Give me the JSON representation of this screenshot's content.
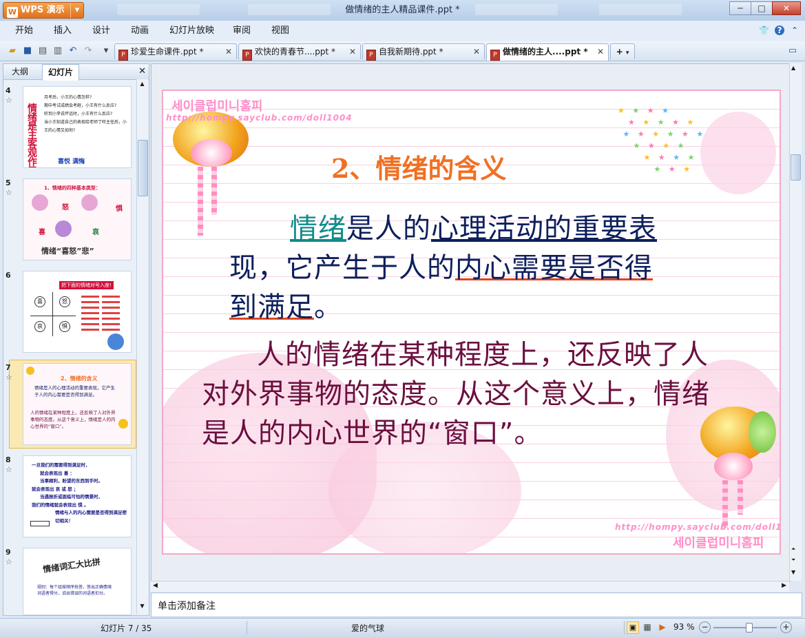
{
  "app": {
    "name": "WPS 演示",
    "window_title": "做情绪的主人精品课件.ppt *"
  },
  "window_buttons": {
    "min": "─",
    "max": "□",
    "close": "✕"
  },
  "menu": [
    "开始",
    "插入",
    "设计",
    "动画",
    "幻灯片放映",
    "审阅",
    "视图"
  ],
  "menu_right": {
    "shirt": "👕",
    "help": "?"
  },
  "doc_tabs": [
    {
      "label": "珍爱生命课件.ppt *"
    },
    {
      "label": "欢快的青春节....ppt *"
    },
    {
      "label": "自我新期待.ppt *"
    },
    {
      "label": "做情绪的主人....ppt *"
    }
  ],
  "doc_tab_add": "+",
  "left_panel": {
    "tab_outline": "大纲",
    "tab_slides": "幻灯片",
    "close": "✕",
    "thumbs": [
      {
        "num": "4",
        "lines": [
          "月考后，小王的心情怎样?",
          "期中考试成绩会考砸，小王有什么反应?",
          "听到小李说坏话时，小王有什么反应?",
          "当小王知道自己的表现给老师丁旺主任后，小王的心情又如何?"
        ],
        "big": "情绪是主客观作用的",
        "bottom": "喜悦  满悔"
      },
      {
        "num": "5",
        "title": "1、情绪的四种基本类型：",
        "words": [
          "怒",
          "惧",
          "喜",
          "哀"
        ],
        "bottom": "情绪“喜怒”悲”"
      },
      {
        "num": "6",
        "title": "把下面的情绪对号入座!",
        "words": [
          "喜",
          "怒",
          "哀",
          "惧"
        ]
      },
      {
        "num": "7",
        "title": "2、情绪的含义",
        "p1": "情绪是人的心理活动的重要表现，它产生于人的内心需要是否得到满足。",
        "p2": "人的情绪在某种程度上，还反映了人对外界事物的态度。从这个意义上，情绪是人的内心世界的“窗口”。"
      },
      {
        "num": "8",
        "lines": [
          "一旦我们的需要得到满足时，",
          "就会表现出 喜 ：",
          "当事顺利，盼望的东西到手时。",
          "就会表现出 哀 或 怒 ；",
          "当遇挫折或面临可怕的情景时，",
          "我们的情绪就会表现出 惧 。",
          "情绪与人的内心需要是否得到满足密切相关！"
        ]
      },
      {
        "num": "9",
        "title": "情绪词汇大比拼",
        "lines": [
          "规则：每个组按顺序抢答，答出正确情绪词语者得分，说出错误的词语者扣分。"
        ]
      }
    ]
  },
  "slide": {
    "title": "2、情绪的含义",
    "p1_parts": [
      "情绪",
      "是人的",
      "心理活动的重要表",
      "现，它产生于人的",
      "内心需要是否得",
      "到满足",
      "。"
    ],
    "p2": "人的情绪在某种程度上，还反映了人对外界事物的态度。从这个意义上，情绪是人的内心世界的“窗口”。",
    "watermark_url": "http://hompy.sayclub.com/doll1004",
    "watermark_kr": "세이클럽미니홈피"
  },
  "notes_placeholder": "单击添加备注",
  "status": {
    "slide_counter": "幻灯片 7 / 35",
    "theme": "爱的气球",
    "zoom": "93 %",
    "zoom_level": 0.55
  },
  "colors": {
    "accent": "#f07022",
    "navy": "#0d1f5c",
    "maroon": "#6b0f3f",
    "teal": "#118b8b",
    "pink": "#f3a9c9"
  }
}
